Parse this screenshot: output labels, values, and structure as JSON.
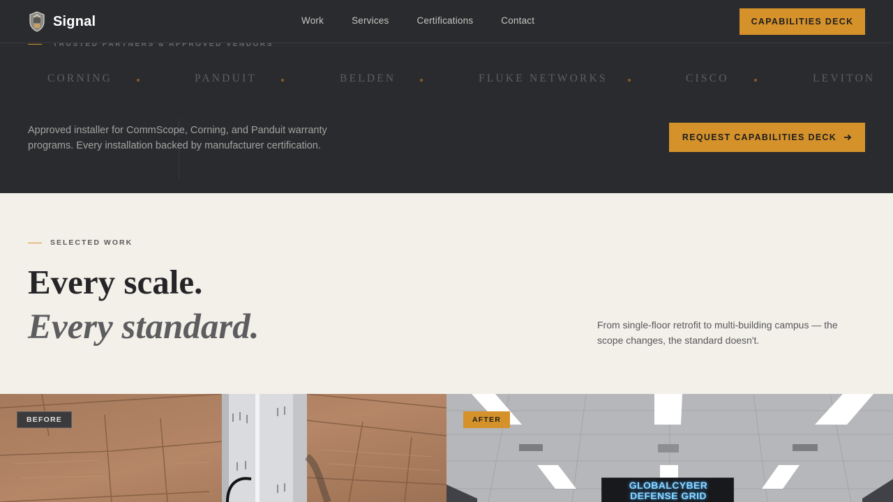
{
  "header": {
    "brand": "Signal",
    "nav": [
      "Work",
      "Services",
      "Certifications",
      "Contact"
    ],
    "cta": "CAPABILITIES DECK"
  },
  "partners": {
    "eyebrow": "TRUSTED PARTNERS & APPROVED VENDORS",
    "logos": [
      "CORNING",
      "PANDUIT",
      "BELDEN",
      "FLUKE NETWORKS",
      "CISCO",
      "LEVITON"
    ],
    "copy": "Approved installer for CommScope, Corning, and Panduit warranty programs. Every installation backed by manufacturer certification.",
    "cta": "REQUEST CAPABILITIES DECK"
  },
  "work": {
    "eyebrow": "SELECTED WORK",
    "headline_1": "Every scale.",
    "headline_2": "Every standard.",
    "copy": "From single-floor retrofit to multi-building campus — the scope changes, the standard doesn't."
  },
  "gallery": {
    "before_label": "BEFORE",
    "after_label": "AFTER",
    "sign_line_1": "GLOBALCYBER",
    "sign_line_2": "DEFENSE GRID"
  },
  "colors": {
    "accent": "#d6922a",
    "dark_bg": "#2a2b2e",
    "light_bg": "#f3f0ea"
  },
  "icons": [
    "brand-logo-icon",
    "arrow-right-icon"
  ]
}
